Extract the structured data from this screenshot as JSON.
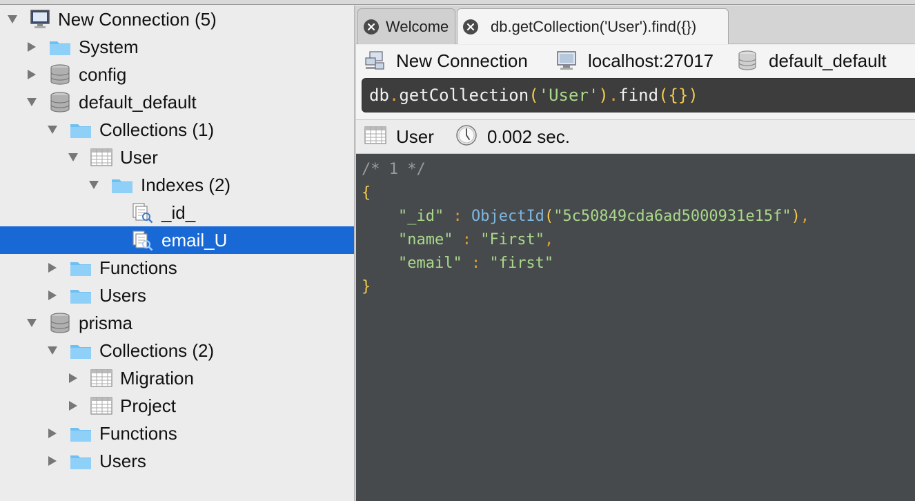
{
  "sidebar": {
    "tree": {
      "connection": "New Connection (5)",
      "system": "System",
      "config": "config",
      "db_default": "default_default",
      "dd_collections": "Collections (1)",
      "dd_user": "User",
      "dd_indexes": "Indexes (2)",
      "idx_id": "_id_",
      "idx_email": "email_U",
      "dd_functions": "Functions",
      "dd_users": "Users",
      "db_prisma": "prisma",
      "pr_collections": "Collections (2)",
      "pr_migration": "Migration",
      "pr_project": "Project",
      "pr_functions": "Functions",
      "pr_users": "Users"
    }
  },
  "tabs": [
    {
      "label": "Welcome",
      "active": false
    },
    {
      "label": "db.getCollection('User').find({})",
      "active": true
    }
  ],
  "connection_bar": {
    "connection": "New Connection",
    "server": "localhost:27017",
    "database": "default_default"
  },
  "query": {
    "obj": "db",
    "method": "getCollection",
    "collection": "'User'",
    "find": "find",
    "arg": "{}"
  },
  "result_bar": {
    "collection": "User",
    "time": "0.002 sec."
  },
  "result": {
    "comment": "/* 1 */",
    "open_brace": "{",
    "close_brace": "}",
    "fields": [
      {
        "key": "\"_id\"",
        "fn": "ObjectId",
        "value": "\"5c50849cda6ad5000931e15f\"",
        "comma": ","
      },
      {
        "key": "\"name\"",
        "value": "\"First\"",
        "comma": ","
      },
      {
        "key": "\"email\"",
        "value": "\"first\"",
        "comma": ""
      }
    ]
  },
  "colors": {
    "selection": "#1869d6",
    "editor_bg": "#474a4d",
    "string": "#a9d88a",
    "brace": "#f2c94c",
    "function": "#7db7e0"
  }
}
